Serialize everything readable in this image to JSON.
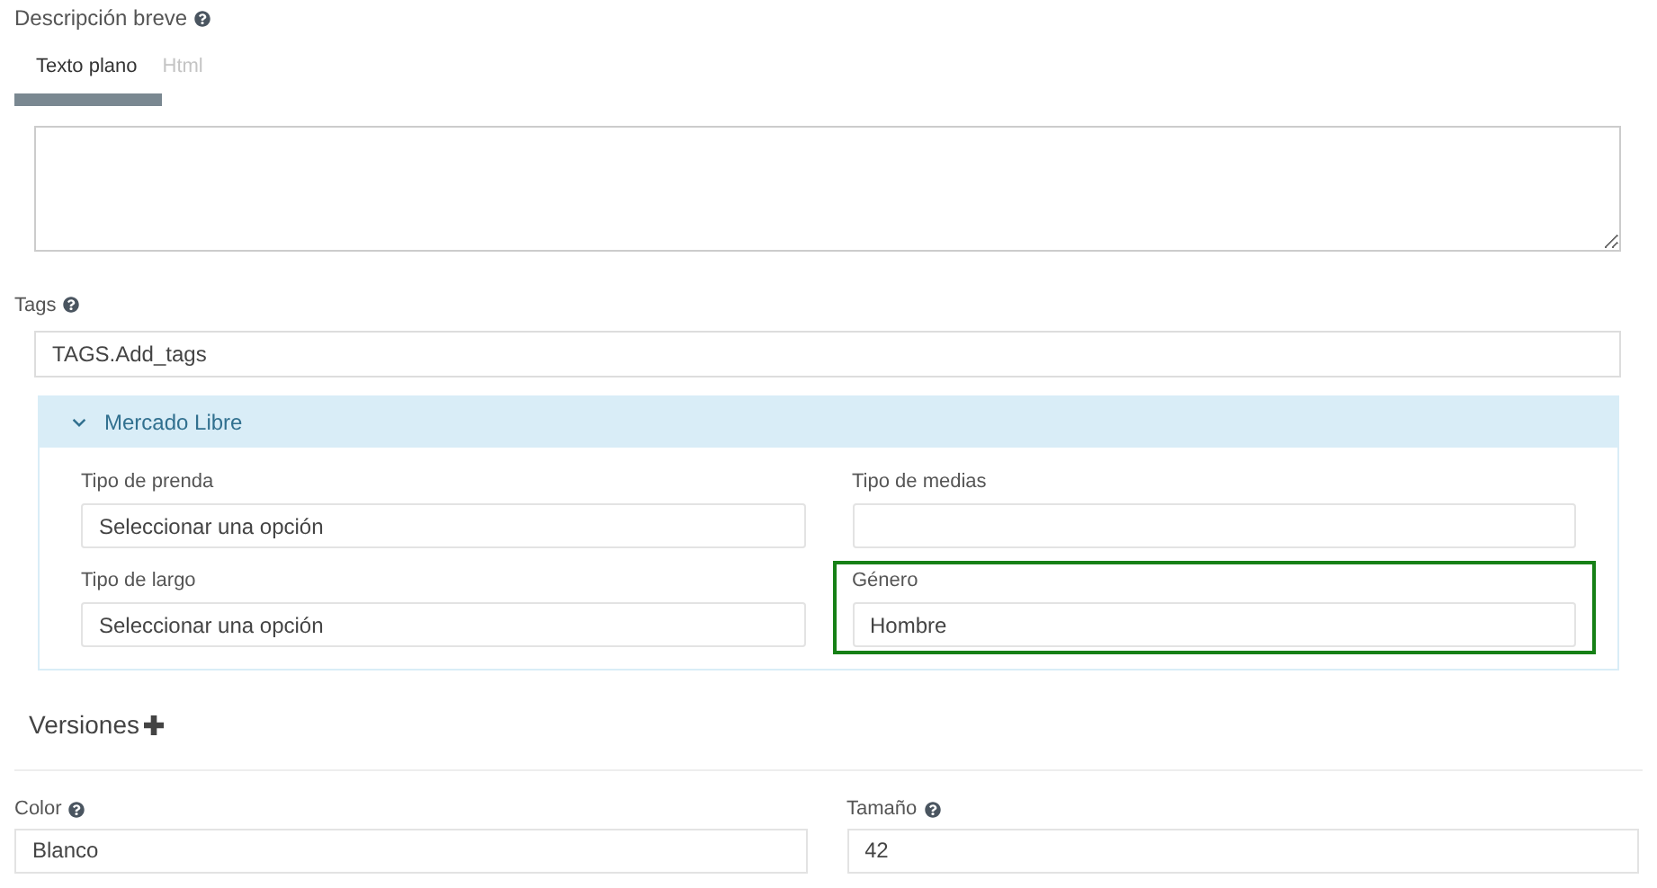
{
  "description": {
    "label": "Descripción breve",
    "tabs": [
      {
        "label": "Texto plano",
        "selected": true
      },
      {
        "label": "Html",
        "selected": false
      }
    ]
  },
  "tags": {
    "label": "Tags",
    "value": "TAGS.Add_tags"
  },
  "panel": {
    "title": "Mercado Libre",
    "expanded": true,
    "fields": [
      {
        "label": "Tipo de prenda",
        "placeholder": "Seleccionar una opción",
        "highlighted": false
      },
      {
        "label": "Tipo de medias",
        "highlighted": false
      },
      {
        "label": "Tipo de largo",
        "placeholder": "Seleccionar una opción",
        "highlighted": false
      },
      {
        "label": "Género",
        "value": "Hombre",
        "highlighted": true
      }
    ]
  },
  "versions": {
    "title": "Versiones",
    "fields": [
      {
        "label": "Color",
        "value": "Blanco"
      },
      {
        "label": "Tamaño",
        "value": "42"
      }
    ]
  }
}
